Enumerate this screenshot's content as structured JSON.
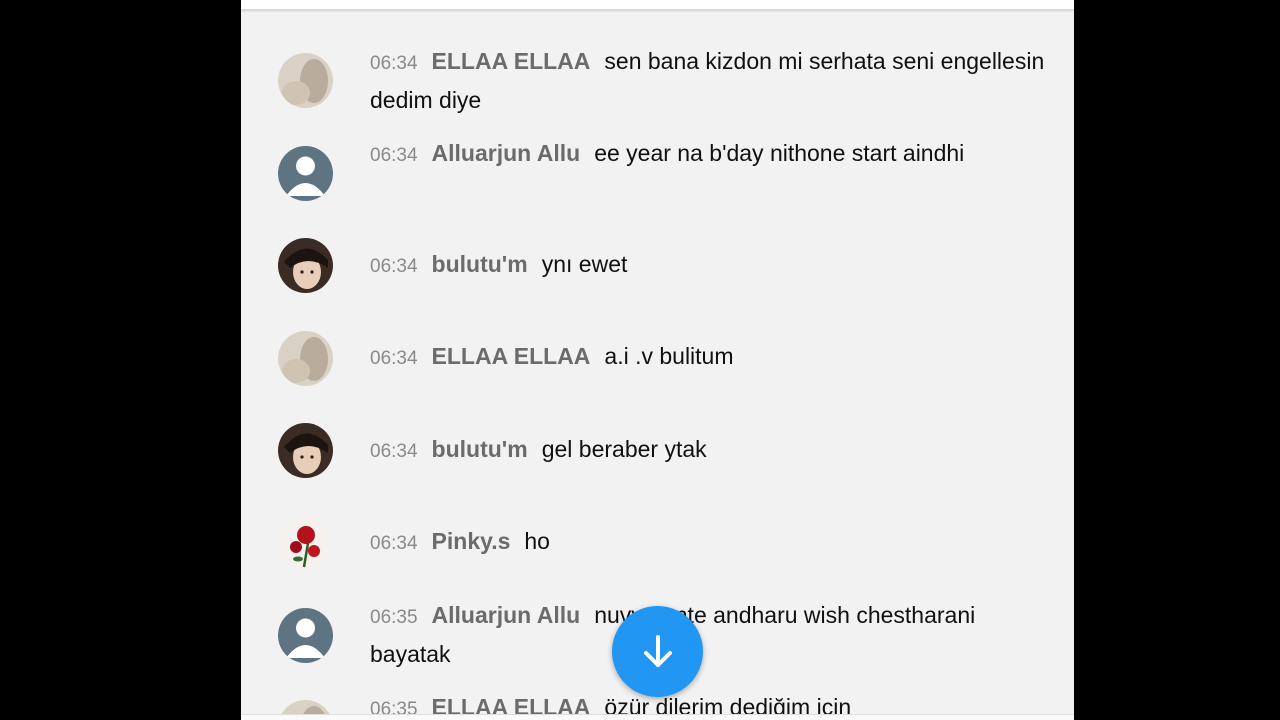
{
  "colors": {
    "background": "#000000",
    "panel": "#f2f2f2",
    "timestamp": "#8a8a8a",
    "author": "#6b6b6b",
    "message": "#101010",
    "fab": "#2196f3"
  },
  "messages": [
    {
      "time": "06:34",
      "author": "ELLAA ELLAA",
      "text": "sen bana kizdon mi serhata seni engellesin dedim diye",
      "avatar": "photo-avatar-beige"
    },
    {
      "time": "06:34",
      "author": "Alluarjun Allu",
      "text": "ee year na b'day nithone start aindhi",
      "avatar": "default-person-avatar"
    },
    {
      "time": "06:34",
      "author": "bulutu'm",
      "text": "ynı ewet",
      "avatar": "photo-avatar-face"
    },
    {
      "time": "06:34",
      "author": "ELLAA ELLAA",
      "text": "a.i .v bulitum",
      "avatar": "photo-avatar-beige"
    },
    {
      "time": "06:34",
      "author": "bulutu'm",
      "text": "gel beraber ytak",
      "avatar": "photo-avatar-face"
    },
    {
      "time": "06:34",
      "author": "Pinky.s",
      "text": "ho",
      "avatar": "rose-avatar"
    },
    {
      "time": "06:35",
      "author": "Alluarjun Allu",
      "text": "nuvvu unte andharu wish chestharani bayatak",
      "avatar": "default-person-avatar"
    },
    {
      "time": "06:35",
      "author": "ELLAA ELLAA",
      "text": "özür dilerim dediğim için",
      "avatar": "photo-avatar-beige"
    }
  ],
  "scroll_button": {
    "icon": "arrow-down-icon"
  }
}
